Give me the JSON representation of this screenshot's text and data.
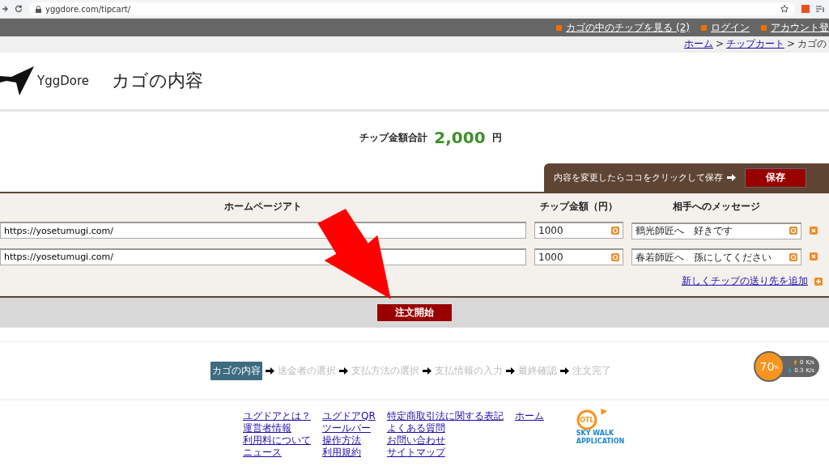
{
  "browser": {
    "url": "yggdore.com/tipcart/"
  },
  "top_nav": {
    "links": [
      "カゴの中のチップを見る (2)",
      "ログイン",
      "アカウント登"
    ]
  },
  "breadcrumb": {
    "links": [
      {
        "label": "ホーム",
        "separator": ">"
      },
      {
        "label": "チップカート",
        "separator": ">"
      }
    ],
    "current": "カゴの"
  },
  "header": {
    "logo_text": "YggDore",
    "title": "カゴの内容"
  },
  "total": {
    "label": "チップ金額合計",
    "amount": "2,000",
    "unit": "円"
  },
  "save_bar": {
    "hint": "内容を変更したらココをクリックして保存",
    "button": "保存"
  },
  "tips_table": {
    "columns": [
      "ホームページアト",
      "チップ金額（円）",
      "相手へのメッセージ"
    ],
    "rows": [
      {
        "address": "https://yosetumugi.com/",
        "amount": "1000",
        "message": "鶴光師匠へ　好きです"
      },
      {
        "address": "https://yosetumugi.com/",
        "amount": "1000",
        "message": "春若師匠へ　孫にしてください"
      }
    ],
    "add_link": "新しくチップの送り先を追加"
  },
  "order_button": "注文開始",
  "steps": [
    {
      "label": "カゴの内容",
      "selected": true
    },
    {
      "label": "送金者の選択",
      "selected": false
    },
    {
      "label": "支払方法の選択",
      "selected": false
    },
    {
      "label": "支払情報の入力",
      "selected": false
    },
    {
      "label": "最終確認",
      "selected": false
    },
    {
      "label": "注文完了",
      "selected": false
    }
  ],
  "net_widget": {
    "percent": "70",
    "percent_unit": "%",
    "up": "0",
    "up_unit": "K/s",
    "down": "0.3",
    "down_unit": "K/s"
  },
  "footer": {
    "columns": [
      [
        "ユグドアとは？",
        "運営者情報",
        "利用料について",
        "ニュース"
      ],
      [
        "ユグドアQR",
        "ツールバー",
        "操作方法",
        "利用規約"
      ],
      [
        "特定商取引法に関する表記",
        "よくある質問",
        "お問い合わせ",
        "サイトマップ"
      ],
      [
        "ホーム"
      ]
    ]
  },
  "partner_logo": {
    "badge": "OTL",
    "lines": [
      "SKY WALK",
      "APPLICATION"
    ]
  }
}
